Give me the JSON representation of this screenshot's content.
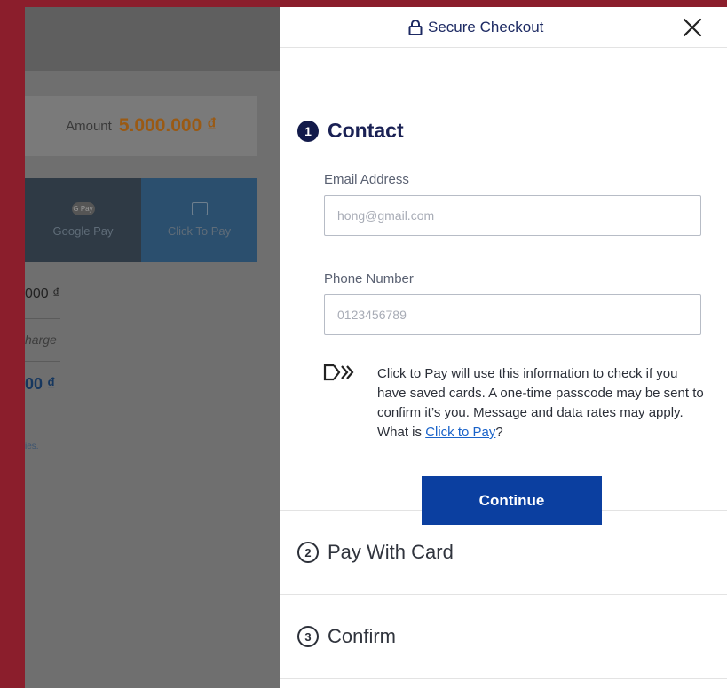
{
  "background_page": {
    "amount_label": "Amount",
    "amount_value": "5.000.000 ₫",
    "tabs": [
      {
        "label": "Google Pay",
        "icon": "gpay-badge-icon",
        "badge": "G Pay"
      },
      {
        "label": "Click To Pay",
        "icon": "card-icon"
      }
    ],
    "lines": [
      "000 ₫",
      "harge",
      "00 ₫"
    ],
    "link_text": "ies."
  },
  "modal": {
    "header": {
      "title": "Secure Checkout",
      "lock_icon": "lock-icon",
      "close_icon": "close-icon"
    },
    "contact": {
      "step_number": "1",
      "title": "Contact",
      "email_label": "Email Address",
      "email_value": "hong@gmail.com",
      "phone_label": "Phone Number",
      "phone_value": "0123456789",
      "info_text": "Click to Pay will use this information to check if you have saved cards. A one-time passcode may be sent to confirm it’s you. Message and data rates may apply. What is ",
      "info_link": "Click to Pay",
      "info_suffix": "?",
      "continue_label": "Continue"
    },
    "steps": [
      {
        "number": "2",
        "title": "Pay With Card"
      },
      {
        "number": "3",
        "title": "Confirm"
      }
    ]
  },
  "colors": {
    "backdrop": "#8b1e2c",
    "navy": "#1a2154",
    "button": "#0b3fa0",
    "link": "#1a63c9"
  }
}
